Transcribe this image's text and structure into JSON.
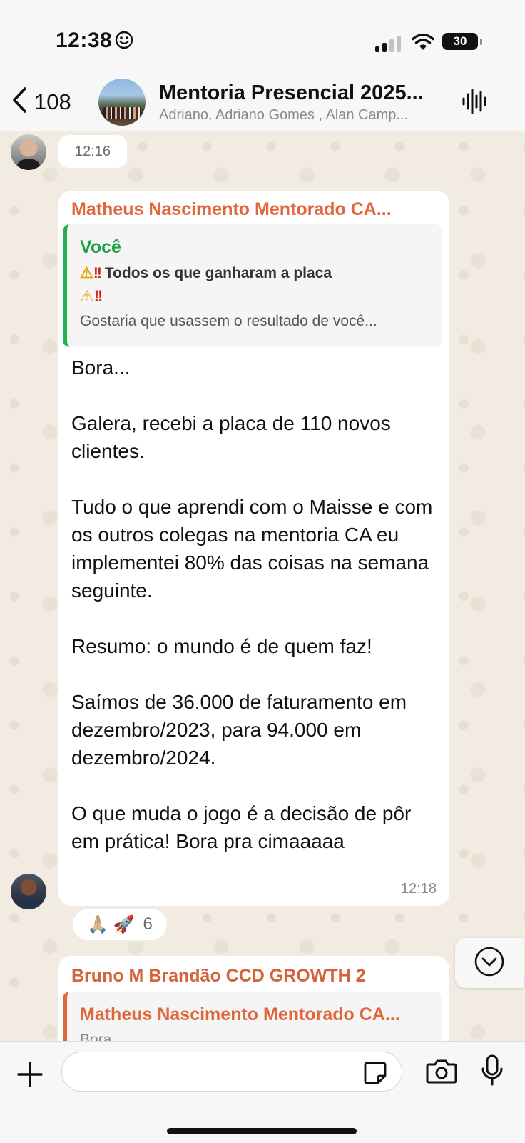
{
  "status_bar": {
    "time": "12:38",
    "battery": "30"
  },
  "header": {
    "back_count": "108",
    "title": "Mentoria Presencial 2025...",
    "members": "Adriano, Adriano Gomes , Alan Camp..."
  },
  "chat": {
    "time_divider": "12:16",
    "message1": {
      "sender": "Matheus Nascimento Mentorado CA...",
      "quote": {
        "author": "Você",
        "line1_label": "Todos os que ganharam a placa",
        "line3": "Gostaria que usassem o resultado de você..."
      },
      "lines": [
        "Bora...",
        "",
        "Galera, recebi a placa de 110 novos clientes.",
        "",
        "Tudo o que aprendi com o Maisse e com os outros colegas na mentoria CA eu implementei 80% das coisas na semana seguinte.",
        "",
        "Resumo: o mundo é de quem faz!",
        "",
        "Saímos de 36.000 de faturamento em dezembro/2023, para 94.000 em dezembro/2024.",
        "",
        "O que muda o jogo é a decisão de pôr em prática! Bora pra cimaaaaa"
      ],
      "time": "12:18"
    },
    "reactions": {
      "emojis": "🙏🏼 🚀",
      "count": "6"
    },
    "message2": {
      "sender": "Bruno M Brandão CCD GROWTH 2",
      "quote": {
        "author": "Matheus Nascimento Mentorado CA...",
        "text": "Bora..."
      }
    }
  },
  "input": {
    "placeholder": ""
  },
  "colors": {
    "sender_orange": "#e0673c",
    "you_green": "#1fa245",
    "chat_bg": "#f1ebe1"
  },
  "icons": [
    "back-chevron-icon",
    "waveform-icon",
    "chevron-down-icon",
    "plus-icon",
    "sticker-icon",
    "camera-icon",
    "microphone-icon",
    "wifi-icon",
    "signal-icon",
    "smiley-icon"
  ]
}
